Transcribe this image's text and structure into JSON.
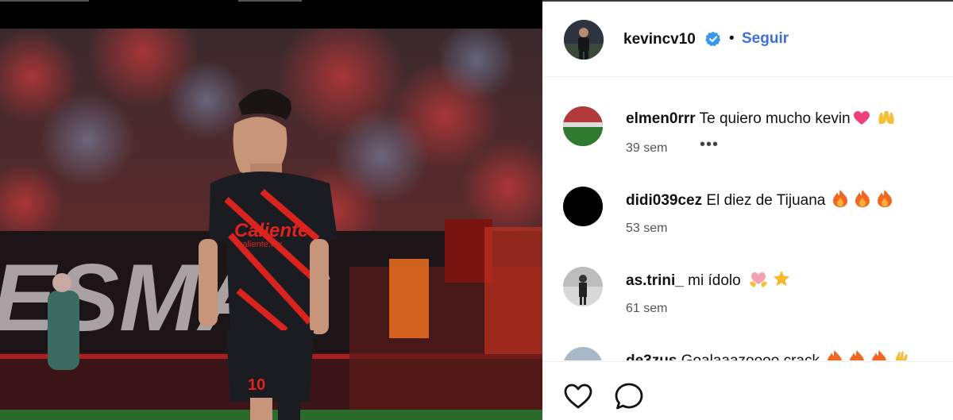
{
  "post": {
    "author": "kevincv10",
    "verified": true,
    "separator": "•",
    "follow_label": "Seguir"
  },
  "comments": [
    {
      "username": "elmen0rrr",
      "text": "Te quiero mucho kevin",
      "emojis": [
        "pink-heart",
        "raised-hands"
      ],
      "time": "39 sem",
      "more": "•••"
    },
    {
      "username": "didi039cez",
      "text": "El diez de Tijuana",
      "emojis": [
        "fire",
        "fire",
        "fire"
      ],
      "time": "53 sem"
    },
    {
      "username": "as.trini_",
      "text": "mi ídolo",
      "emojis": [
        "heart-hands",
        "star"
      ],
      "time": "61 sem"
    },
    {
      "username": "de3zus",
      "text": "Goalaaazoooo crack",
      "emojis": [
        "fire",
        "fire",
        "fire",
        "raised-hand"
      ],
      "time": ""
    }
  ],
  "actions": {
    "like_icon": "heart-outline",
    "comment_icon": "speech-bubble"
  },
  "photo": {
    "jersey_sponsor": "Caliente",
    "jersey_sponsor_sub": "caliente.mx",
    "jersey_number": "10",
    "banner_text": "ES MAS"
  },
  "colors": {
    "accent": "#3f6fd6",
    "verified": "#3797f0",
    "jersey_red": "#e0231c"
  }
}
